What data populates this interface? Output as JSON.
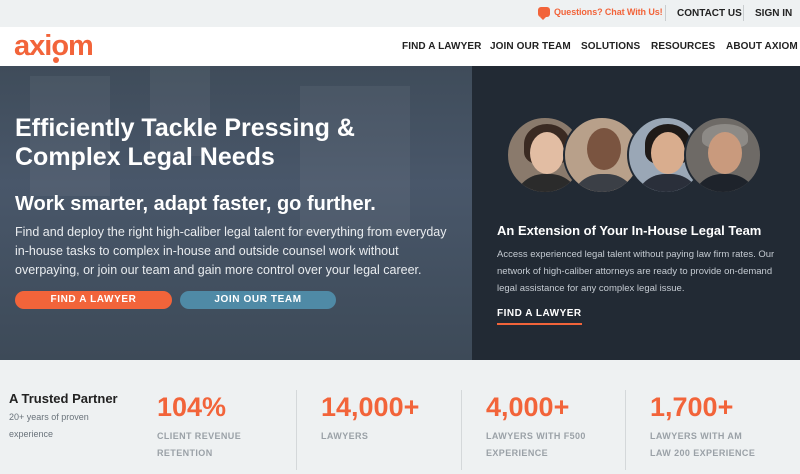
{
  "colors": {
    "accent": "#f2643a",
    "teal": "#4f8aa6",
    "dark_panel": "#222a34",
    "strip": "#eef1f2"
  },
  "utility": {
    "chat_label": "Questions? Chat With Us!",
    "contact_label": "CONTACT US",
    "signin_label": "SIGN IN"
  },
  "brand": {
    "logo": "axiom"
  },
  "nav": {
    "items": [
      {
        "label": "FIND A LAWYER"
      },
      {
        "label": "JOIN OUR TEAM"
      },
      {
        "label": "SOLUTIONS"
      },
      {
        "label": "RESOURCES"
      },
      {
        "label": "ABOUT AXIOM"
      }
    ]
  },
  "hero": {
    "title": "Efficiently Tackle Pressing & Complex Legal Needs",
    "subtitle": "Work smarter, adapt faster, go further.",
    "body": "Find and deploy the right high-caliber legal talent for everything from everyday in-house tasks to complex in-house and outside counsel work without overpaying, or join our team and gain more control over your legal career.",
    "primary_button": "FIND A LAWYER",
    "secondary_button": "JOIN OUR TEAM"
  },
  "extension": {
    "title": "An Extension of Your In-House Legal Team",
    "body": "Access experienced legal talent without paying law firm rates. Our network of high-caliber attorneys are ready to provide on-demand legal assistance for any complex legal issue.",
    "link": "FIND A LAWYER"
  },
  "stats": {
    "intro_title": "A Trusted Partner",
    "intro_sub": "20+ years of proven experience",
    "items": [
      {
        "value": "104%",
        "label": "CLIENT REVENUE RETENTION"
      },
      {
        "value": "14,000+",
        "label": "LAWYERS"
      },
      {
        "value": "4,000+",
        "label": "LAWYERS WITH F500 EXPERIENCE"
      },
      {
        "value": "1,700+",
        "label": "LAWYERS WITH AM LAW 200 EXPERIENCE"
      }
    ]
  }
}
